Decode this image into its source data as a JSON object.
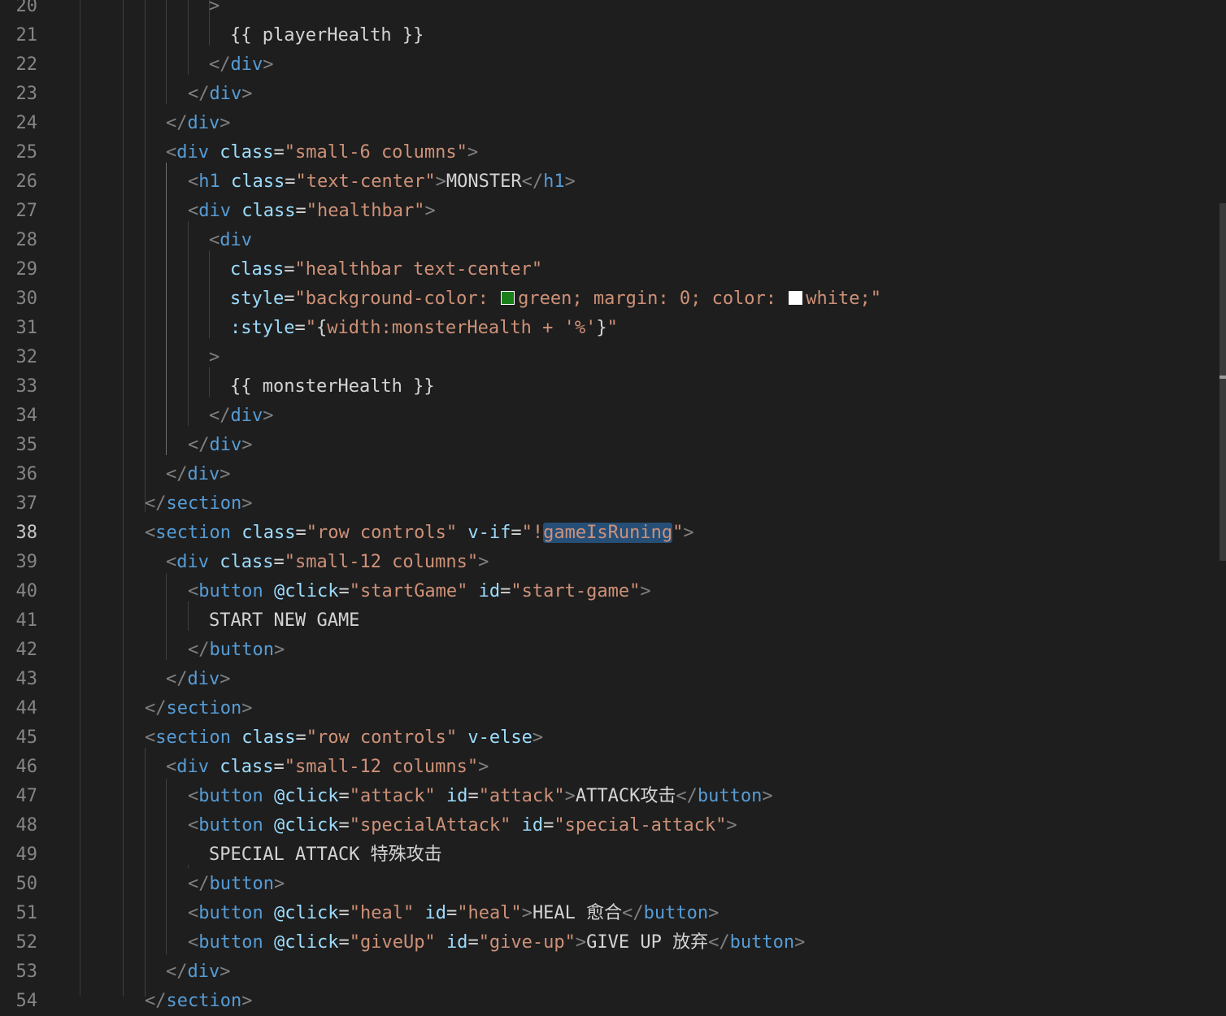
{
  "editor": {
    "active_line": "38",
    "swatch_colors": {
      "green": "#1a7f1a",
      "white": "#ffffff"
    },
    "lines": [
      {
        "n": "20",
        "tokens": [
          {
            "t": "pun",
            "v": ">"
          }
        ]
      },
      {
        "n": "21",
        "tokens": [
          {
            "t": "txt",
            "v": "{{ playerHealth }}"
          }
        ]
      },
      {
        "n": "22",
        "tokens": [
          {
            "t": "pun",
            "v": "</"
          },
          {
            "t": "tag",
            "v": "div"
          },
          {
            "t": "pun",
            "v": ">"
          }
        ]
      },
      {
        "n": "23",
        "tokens": [
          {
            "t": "pun",
            "v": "</"
          },
          {
            "t": "tag",
            "v": "div"
          },
          {
            "t": "pun",
            "v": ">"
          }
        ]
      },
      {
        "n": "24",
        "tokens": [
          {
            "t": "pun",
            "v": "</"
          },
          {
            "t": "tag",
            "v": "div"
          },
          {
            "t": "pun",
            "v": ">"
          }
        ]
      },
      {
        "n": "25",
        "tokens": [
          {
            "t": "pun",
            "v": "<"
          },
          {
            "t": "tag",
            "v": "div"
          },
          {
            "t": "txt",
            "v": " "
          },
          {
            "t": "attr",
            "v": "class"
          },
          {
            "t": "txt",
            "v": "="
          },
          {
            "t": "str",
            "v": "\"small-6 columns\""
          },
          {
            "t": "pun",
            "v": ">"
          }
        ]
      },
      {
        "n": "26",
        "tokens": [
          {
            "t": "pun",
            "v": "<"
          },
          {
            "t": "tag",
            "v": "h1"
          },
          {
            "t": "txt",
            "v": " "
          },
          {
            "t": "attr",
            "v": "class"
          },
          {
            "t": "txt",
            "v": "="
          },
          {
            "t": "str",
            "v": "\"text-center\""
          },
          {
            "t": "pun",
            "v": ">"
          },
          {
            "t": "txt",
            "v": "MONSTER"
          },
          {
            "t": "pun",
            "v": "</"
          },
          {
            "t": "tag",
            "v": "h1"
          },
          {
            "t": "pun",
            "v": ">"
          }
        ]
      },
      {
        "n": "27",
        "tokens": [
          {
            "t": "pun",
            "v": "<"
          },
          {
            "t": "tag",
            "v": "div"
          },
          {
            "t": "txt",
            "v": " "
          },
          {
            "t": "attr",
            "v": "class"
          },
          {
            "t": "txt",
            "v": "="
          },
          {
            "t": "str",
            "v": "\"healthbar\""
          },
          {
            "t": "pun",
            "v": ">"
          }
        ]
      },
      {
        "n": "28",
        "tokens": [
          {
            "t": "pun",
            "v": "<"
          },
          {
            "t": "tag",
            "v": "div"
          }
        ]
      },
      {
        "n": "29",
        "tokens": [
          {
            "t": "attr",
            "v": "class"
          },
          {
            "t": "txt",
            "v": "="
          },
          {
            "t": "str",
            "v": "\"healthbar text-center\""
          }
        ]
      },
      {
        "n": "30",
        "tokens": [
          {
            "t": "attr",
            "v": "style"
          },
          {
            "t": "txt",
            "v": "="
          },
          {
            "t": "str",
            "v": "\"background-color: "
          },
          {
            "t": "swatch",
            "v": "green"
          },
          {
            "t": "str",
            "v": "green; margin: 0; color: "
          },
          {
            "t": "swatch",
            "v": "white"
          },
          {
            "t": "str",
            "v": "white;\""
          }
        ]
      },
      {
        "n": "31",
        "tokens": [
          {
            "t": "attr",
            "v": ":style"
          },
          {
            "t": "txt",
            "v": "="
          },
          {
            "t": "str",
            "v": "\""
          },
          {
            "t": "txt",
            "v": "{"
          },
          {
            "t": "str",
            "v": "width:monsterHealth + '%'"
          },
          {
            "t": "txt",
            "v": "}"
          },
          {
            "t": "str",
            "v": "\""
          }
        ]
      },
      {
        "n": "32",
        "tokens": [
          {
            "t": "pun",
            "v": ">"
          }
        ]
      },
      {
        "n": "33",
        "tokens": [
          {
            "t": "txt",
            "v": "{{ monsterHealth }}"
          }
        ]
      },
      {
        "n": "34",
        "tokens": [
          {
            "t": "pun",
            "v": "</"
          },
          {
            "t": "tag",
            "v": "div"
          },
          {
            "t": "pun",
            "v": ">"
          }
        ]
      },
      {
        "n": "35",
        "tokens": [
          {
            "t": "pun",
            "v": "</"
          },
          {
            "t": "tag",
            "v": "div"
          },
          {
            "t": "pun",
            "v": ">"
          }
        ]
      },
      {
        "n": "36",
        "tokens": [
          {
            "t": "pun",
            "v": "</"
          },
          {
            "t": "tag",
            "v": "div"
          },
          {
            "t": "pun",
            "v": ">"
          }
        ]
      },
      {
        "n": "37",
        "tokens": [
          {
            "t": "pun",
            "v": "</"
          },
          {
            "t": "tag",
            "v": "section"
          },
          {
            "t": "pun",
            "v": ">"
          }
        ]
      },
      {
        "n": "38",
        "tokens": [
          {
            "t": "pun",
            "v": "<"
          },
          {
            "t": "tag",
            "v": "section"
          },
          {
            "t": "txt",
            "v": " "
          },
          {
            "t": "attr",
            "v": "class"
          },
          {
            "t": "txt",
            "v": "="
          },
          {
            "t": "str",
            "v": "\"row controls\""
          },
          {
            "t": "txt",
            "v": " "
          },
          {
            "t": "attr",
            "v": "v-if"
          },
          {
            "t": "txt",
            "v": "="
          },
          {
            "t": "str",
            "v": "\"!"
          },
          {
            "t": "hl",
            "v": "gameIsRuning"
          },
          {
            "t": "str",
            "v": "\""
          },
          {
            "t": "pun",
            "v": ">"
          }
        ]
      },
      {
        "n": "39",
        "tokens": [
          {
            "t": "pun",
            "v": "<"
          },
          {
            "t": "tag",
            "v": "div"
          },
          {
            "t": "txt",
            "v": " "
          },
          {
            "t": "attr",
            "v": "class"
          },
          {
            "t": "txt",
            "v": "="
          },
          {
            "t": "str",
            "v": "\"small-12 columns\""
          },
          {
            "t": "pun",
            "v": ">"
          }
        ]
      },
      {
        "n": "40",
        "tokens": [
          {
            "t": "pun",
            "v": "<"
          },
          {
            "t": "tag",
            "v": "button"
          },
          {
            "t": "txt",
            "v": " "
          },
          {
            "t": "attr",
            "v": "@click"
          },
          {
            "t": "txt",
            "v": "="
          },
          {
            "t": "str",
            "v": "\"startGame\""
          },
          {
            "t": "txt",
            "v": " "
          },
          {
            "t": "attr",
            "v": "id"
          },
          {
            "t": "txt",
            "v": "="
          },
          {
            "t": "str",
            "v": "\"start-game\""
          },
          {
            "t": "pun",
            "v": ">"
          }
        ]
      },
      {
        "n": "41",
        "tokens": [
          {
            "t": "txt",
            "v": "START NEW GAME"
          }
        ]
      },
      {
        "n": "42",
        "tokens": [
          {
            "t": "pun",
            "v": "</"
          },
          {
            "t": "tag",
            "v": "button"
          },
          {
            "t": "pun",
            "v": ">"
          }
        ]
      },
      {
        "n": "43",
        "tokens": [
          {
            "t": "pun",
            "v": "</"
          },
          {
            "t": "tag",
            "v": "div"
          },
          {
            "t": "pun",
            "v": ">"
          }
        ]
      },
      {
        "n": "44",
        "tokens": [
          {
            "t": "pun",
            "v": "</"
          },
          {
            "t": "tag",
            "v": "section"
          },
          {
            "t": "pun",
            "v": ">"
          }
        ]
      },
      {
        "n": "45",
        "tokens": [
          {
            "t": "pun",
            "v": "<"
          },
          {
            "t": "tag",
            "v": "section"
          },
          {
            "t": "txt",
            "v": " "
          },
          {
            "t": "attr",
            "v": "class"
          },
          {
            "t": "txt",
            "v": "="
          },
          {
            "t": "str",
            "v": "\"row controls\""
          },
          {
            "t": "txt",
            "v": " "
          },
          {
            "t": "attr",
            "v": "v-else"
          },
          {
            "t": "pun",
            "v": ">"
          }
        ]
      },
      {
        "n": "46",
        "tokens": [
          {
            "t": "pun",
            "v": "<"
          },
          {
            "t": "tag",
            "v": "div"
          },
          {
            "t": "txt",
            "v": " "
          },
          {
            "t": "attr",
            "v": "class"
          },
          {
            "t": "txt",
            "v": "="
          },
          {
            "t": "str",
            "v": "\"small-12 columns\""
          },
          {
            "t": "pun",
            "v": ">"
          }
        ]
      },
      {
        "n": "47",
        "tokens": [
          {
            "t": "pun",
            "v": "<"
          },
          {
            "t": "tag",
            "v": "button"
          },
          {
            "t": "txt",
            "v": " "
          },
          {
            "t": "attr",
            "v": "@click"
          },
          {
            "t": "txt",
            "v": "="
          },
          {
            "t": "str",
            "v": "\"attack\""
          },
          {
            "t": "txt",
            "v": " "
          },
          {
            "t": "attr",
            "v": "id"
          },
          {
            "t": "txt",
            "v": "="
          },
          {
            "t": "str",
            "v": "\"attack\""
          },
          {
            "t": "pun",
            "v": ">"
          },
          {
            "t": "txt",
            "v": "ATTACK攻击"
          },
          {
            "t": "pun",
            "v": "</"
          },
          {
            "t": "tag",
            "v": "button"
          },
          {
            "t": "pun",
            "v": ">"
          }
        ]
      },
      {
        "n": "48",
        "tokens": [
          {
            "t": "pun",
            "v": "<"
          },
          {
            "t": "tag",
            "v": "button"
          },
          {
            "t": "txt",
            "v": " "
          },
          {
            "t": "attr",
            "v": "@click"
          },
          {
            "t": "txt",
            "v": "="
          },
          {
            "t": "str",
            "v": "\"specialAttack\""
          },
          {
            "t": "txt",
            "v": " "
          },
          {
            "t": "attr",
            "v": "id"
          },
          {
            "t": "txt",
            "v": "="
          },
          {
            "t": "str",
            "v": "\"special-attack\""
          },
          {
            "t": "pun",
            "v": ">"
          }
        ]
      },
      {
        "n": "49",
        "tokens": [
          {
            "t": "txt",
            "v": "SPECIAL ATTACK 特殊攻击"
          }
        ]
      },
      {
        "n": "50",
        "tokens": [
          {
            "t": "pun",
            "v": "</"
          },
          {
            "t": "tag",
            "v": "button"
          },
          {
            "t": "pun",
            "v": ">"
          }
        ]
      },
      {
        "n": "51",
        "tokens": [
          {
            "t": "pun",
            "v": "<"
          },
          {
            "t": "tag",
            "v": "button"
          },
          {
            "t": "txt",
            "v": " "
          },
          {
            "t": "attr",
            "v": "@click"
          },
          {
            "t": "txt",
            "v": "="
          },
          {
            "t": "str",
            "v": "\"heal\""
          },
          {
            "t": "txt",
            "v": " "
          },
          {
            "t": "attr",
            "v": "id"
          },
          {
            "t": "txt",
            "v": "="
          },
          {
            "t": "str",
            "v": "\"heal\""
          },
          {
            "t": "pun",
            "v": ">"
          },
          {
            "t": "txt",
            "v": "HEAL 愈合"
          },
          {
            "t": "pun",
            "v": "</"
          },
          {
            "t": "tag",
            "v": "button"
          },
          {
            "t": "pun",
            "v": ">"
          }
        ]
      },
      {
        "n": "52",
        "tokens": [
          {
            "t": "pun",
            "v": "<"
          },
          {
            "t": "tag",
            "v": "button"
          },
          {
            "t": "txt",
            "v": " "
          },
          {
            "t": "attr",
            "v": "@click"
          },
          {
            "t": "txt",
            "v": "="
          },
          {
            "t": "str",
            "v": "\"giveUp\""
          },
          {
            "t": "txt",
            "v": " "
          },
          {
            "t": "attr",
            "v": "id"
          },
          {
            "t": "txt",
            "v": "="
          },
          {
            "t": "str",
            "v": "\"give-up\""
          },
          {
            "t": "pun",
            "v": ">"
          },
          {
            "t": "txt",
            "v": "GIVE UP 放弃"
          },
          {
            "t": "pun",
            "v": "</"
          },
          {
            "t": "tag",
            "v": "button"
          },
          {
            "t": "pun",
            "v": ">"
          }
        ]
      },
      {
        "n": "53",
        "tokens": [
          {
            "t": "pun",
            "v": "</"
          },
          {
            "t": "tag",
            "v": "div"
          },
          {
            "t": "pun",
            "v": ">"
          }
        ]
      },
      {
        "n": "54",
        "tokens": [
          {
            "t": "pun",
            "v": "</"
          },
          {
            "t": "tag",
            "v": "section"
          },
          {
            "t": "pun",
            "v": ">"
          }
        ]
      }
    ]
  }
}
